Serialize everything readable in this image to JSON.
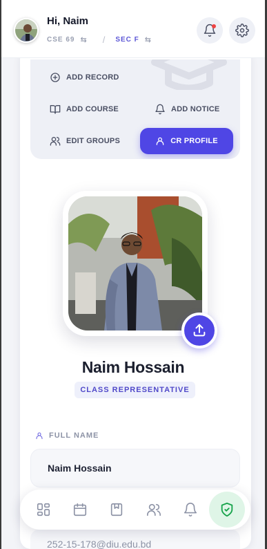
{
  "header": {
    "greeting": "Hi, Naim",
    "batch": "CSE 69",
    "section": "SEC F",
    "swap_icon": "⇆",
    "divider": "/"
  },
  "actions": {
    "add_record": "ADD RECORD",
    "add_course": "ADD COURSE",
    "add_notice": "ADD NOTICE",
    "edit_groups": "EDIT GROUPS",
    "cr_profile": "CR PROFILE"
  },
  "profile": {
    "name": "Naim Hossain",
    "role": "CLASS REPRESENTATIVE",
    "full_name_label": "FULL NAME",
    "full_name_value": "Naim Hossain",
    "email_value": "252-15-178@diu.edu.bd"
  },
  "nav": {
    "items": [
      "dashboard-icon",
      "calendar-icon",
      "bookmark-icon",
      "users-icon",
      "bell-icon",
      "shield-check-icon"
    ],
    "active": "shield-check-icon"
  },
  "colors": {
    "accent": "#4f46e5",
    "active_nav_bg": "#dff5e7",
    "active_nav_icon": "#16a34a",
    "notification_dot": "#ef4444"
  }
}
